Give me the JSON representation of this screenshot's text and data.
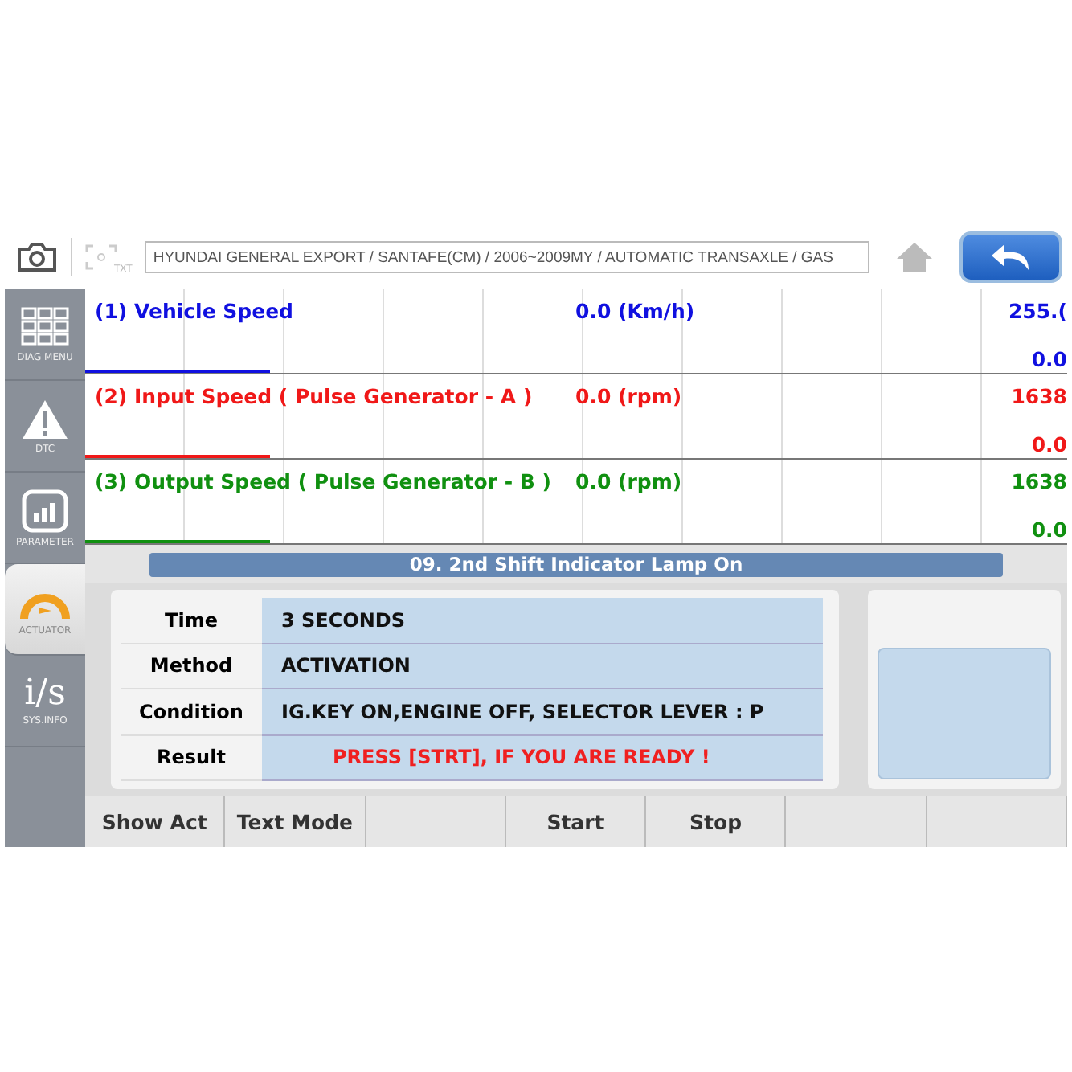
{
  "toolbar": {
    "path": "HYUNDAI GENERAL EXPORT / SANTAFE(CM) / 2006~2009MY / AUTOMATIC TRANSAXLE / GAS",
    "txt_label": "TXT"
  },
  "sidebar": {
    "items": [
      {
        "kind": "grid",
        "label": "DIAG MENU",
        "selected": false
      },
      {
        "kind": "warning",
        "label": "DTC",
        "selected": false
      },
      {
        "kind": "chart",
        "label": "PARAMETER",
        "selected": false
      },
      {
        "kind": "gauge",
        "label": "ACTUATOR",
        "selected": true
      },
      {
        "kind": "glyph",
        "glyph": "i/s",
        "label": "SYS.INFO",
        "selected": false
      }
    ]
  },
  "graphs": [
    {
      "name": "(1) Vehicle Speed",
      "reading": "0.0 (Km/h)",
      "max": "255.(",
      "min": "0.0",
      "color": "#1010e0"
    },
    {
      "name": "(2) Input Speed ( Pulse Generator - A )",
      "reading": "0.0 (rpm)",
      "max": "1638",
      "min": "0.0",
      "color": "#f01818"
    },
    {
      "name": "(3) Output Speed ( Pulse Generator - B )",
      "reading": "0.0 (rpm)",
      "max": "1638",
      "min": "0.0",
      "color": "#109010"
    }
  ],
  "test_title": "09. 2nd Shift Indicator Lamp On",
  "details": [
    {
      "label": "Time",
      "value": "3 SECONDS",
      "kind": "normal"
    },
    {
      "label": "Method",
      "value": "ACTIVATION",
      "kind": "normal"
    },
    {
      "label": "Condition",
      "value": "IG.KEY ON,ENGINE OFF, SELECTOR LEVER : P",
      "kind": "normal"
    },
    {
      "label": "Result",
      "value": "PRESS [STRT], IF YOU ARE READY !",
      "kind": "alert"
    }
  ],
  "buttons": [
    {
      "kind": "button",
      "label": "Show Act"
    },
    {
      "kind": "button",
      "label": "Text Mode"
    },
    {
      "kind": "empty"
    },
    {
      "kind": "button",
      "label": "Start"
    },
    {
      "kind": "button",
      "label": "Stop"
    },
    {
      "kind": "empty"
    },
    {
      "kind": "empty"
    }
  ]
}
